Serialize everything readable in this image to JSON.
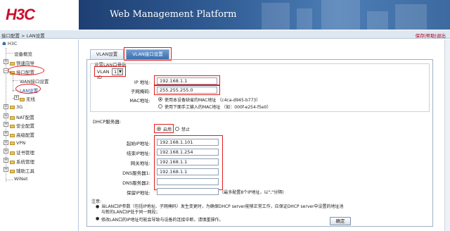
{
  "header": {
    "logo": "H3C",
    "title": "Web Management Platform"
  },
  "pathbar": {
    "breadcrumb": "接口配置 > LAN设置",
    "links": [
      "保存",
      "帮助",
      "退出"
    ]
  },
  "sidebar": {
    "root": "H3C",
    "items": [
      {
        "label": "设备概览"
      },
      {
        "label": "快速向导"
      },
      {
        "label": "接口配置"
      },
      {
        "label": "WAN接口设置"
      },
      {
        "label": "LAN设置"
      },
      {
        "label": "无线"
      },
      {
        "label": "3G"
      },
      {
        "label": "NAT配置"
      },
      {
        "label": "安全配置"
      },
      {
        "label": "高级配置"
      },
      {
        "label": "VPN"
      },
      {
        "label": "证书管理"
      },
      {
        "label": "系统管理"
      },
      {
        "label": "辅助工具"
      },
      {
        "label": "WiNet"
      }
    ]
  },
  "tabs": [
    {
      "label": "VLAN设置"
    },
    {
      "label": "VLAN接口设置"
    }
  ],
  "form": {
    "lan_section_title": "设置LAN口参数",
    "vlan_id_label": "VLAN ID",
    "vlan_id_value": "1",
    "ip_label": "IP 地址:",
    "ip_value": "192.168.1.1",
    "mask_label": "子网掩码:",
    "mask_value": "255.255.255.0",
    "mac_label": "MAC地址:",
    "mac_option1": "使用本设备缺省的MAC地址 （c4ca-d945-b773）",
    "mac_option2": "使用下面手工输入的MAC地址 （如：000f-e254-f5e0）",
    "dhcp_title": "DHCP服务器:",
    "dhcp_enable": "启用",
    "dhcp_disable": "禁止",
    "start_ip_label": "起始IP地址:",
    "start_ip_value": "192.168.1.101",
    "end_ip_label": "结束IP地址:",
    "end_ip_value": "192.168.1.254",
    "gateway_label": "网关地址:",
    "gateway_value": "192.168.1.1",
    "dns1_label": "DNS服务器1:",
    "dns1_value": "192.168.1.1",
    "dns2_label": "DNS服务器2:",
    "dns2_value": "",
    "reserved_label": "保留IP地址:",
    "reserved_value": "",
    "reserved_hint": "(最多配置8个IP地址，以\";\"分隔)",
    "note_title": "注意:",
    "note1": "当LAN口IP参数（包括IP地址、子网掩码）发生变更时，为确保DHCP server能够正常工作，应保证DHCP server中设置的地址池与新的LAN口IP处于同一网段；",
    "note2": "修改LAN口的IP地址可能会导致与设备的连接中断，请慎重操作。",
    "confirm_label": "确定"
  }
}
